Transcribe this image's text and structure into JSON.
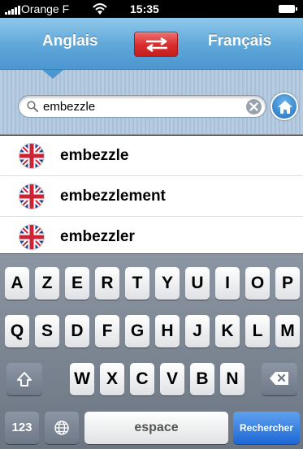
{
  "status_bar": {
    "carrier": "Orange F",
    "time": "15:35"
  },
  "header": {
    "source_language": "Anglais",
    "target_language": "Français"
  },
  "search": {
    "query": "embezzle"
  },
  "results": [
    {
      "word": "embezzle"
    },
    {
      "word": "embezzlement"
    },
    {
      "word": "embezzler"
    }
  ],
  "keyboard": {
    "row1": [
      "A",
      "Z",
      "E",
      "R",
      "T",
      "Y",
      "U",
      "I",
      "O",
      "P"
    ],
    "row2": [
      "Q",
      "S",
      "D",
      "F",
      "G",
      "H",
      "J",
      "K",
      "L",
      "M"
    ],
    "row3": [
      "W",
      "X",
      "C",
      "V",
      "B",
      "N"
    ],
    "numbers_label": "123",
    "space_label": "espace",
    "search_label": "Rechercher"
  },
  "colors": {
    "header_blue": "#5fa6d9",
    "swap_red": "#d72b2b",
    "search_key_blue": "#1e68d6"
  }
}
